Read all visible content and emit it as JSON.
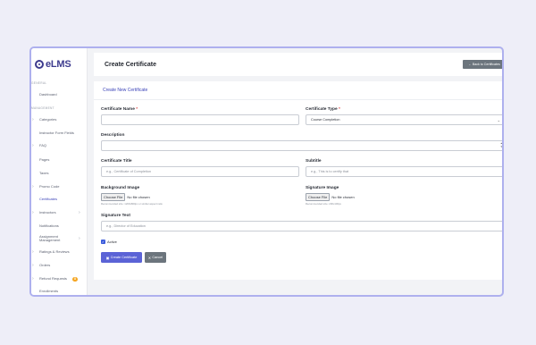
{
  "app": {
    "logo_text": "eLMS"
  },
  "sidebar": {
    "section_main": "General",
    "section_management": "Management",
    "items": [
      {
        "label": "Dashboard"
      },
      {
        "label": "Categories"
      },
      {
        "label": "Instructor Form Fields"
      },
      {
        "label": "FAQ"
      },
      {
        "label": "Pages"
      },
      {
        "label": "Taxes"
      },
      {
        "label": "Promo Code"
      },
      {
        "label": "Certificates",
        "active": true
      },
      {
        "label": "Instructors"
      },
      {
        "label": "Notifications"
      },
      {
        "label": "Assignment Management"
      },
      {
        "label": "Ratings & Reviews"
      },
      {
        "label": "Orders"
      },
      {
        "label": "Refund Requests",
        "badge": "8"
      },
      {
        "label": "Enrollments"
      }
    ]
  },
  "header": {
    "title": "Create Certificate",
    "back_button": "Back to Certificates",
    "back_icon": "arrow-left-icon"
  },
  "form": {
    "card_title": "Create New Certificate",
    "name": {
      "label": "Certificate Name",
      "value": ""
    },
    "type": {
      "label": "Certificate Type",
      "value": "Course Completion"
    },
    "description": {
      "label": "Description",
      "value": ""
    },
    "cert_title": {
      "label": "Certificate Title",
      "placeholder": "e.g., Certificate of Completion"
    },
    "subtitle": {
      "label": "Subtitle",
      "placeholder": "e.g., This is to certify that"
    },
    "background": {
      "label": "Background Image",
      "button": "Choose File",
      "status": "No file chosen",
      "hint": "Recommended size: 1200x800px or similar aspect ratio"
    },
    "signature": {
      "label": "Signature Image",
      "button": "Choose File",
      "status": "No file chosen",
      "hint": "Recommended size: 200x100px"
    },
    "signature_text": {
      "label": "Signature Text",
      "placeholder": "e.g., Director of Education"
    },
    "active": {
      "label": "Active",
      "checked": true
    },
    "submit": "Create Certificate",
    "cancel": "Cancel"
  },
  "colors": {
    "accent": "#5b63d6",
    "brand": "#3d3b8e",
    "secondary": "#6c757d",
    "badge": "#f5a623"
  }
}
